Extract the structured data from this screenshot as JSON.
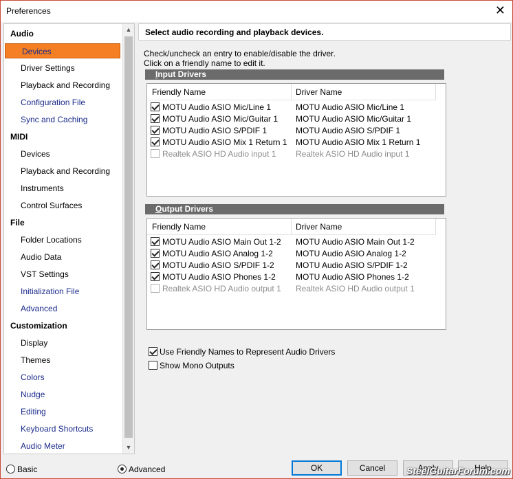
{
  "window": {
    "title": "Preferences",
    "close_glyph": "✕"
  },
  "sidebar": {
    "items": [
      {
        "label": "Audio",
        "kind": "head"
      },
      {
        "label": "Devices",
        "kind": "sub",
        "selected": true
      },
      {
        "label": "Driver Settings",
        "kind": "sub"
      },
      {
        "label": "Playback and Recording",
        "kind": "sub"
      },
      {
        "label": "Configuration File",
        "kind": "sub",
        "link": true
      },
      {
        "label": "Sync and Caching",
        "kind": "sub",
        "link": true
      },
      {
        "label": "MIDI",
        "kind": "head"
      },
      {
        "label": "Devices",
        "kind": "sub"
      },
      {
        "label": "Playback and Recording",
        "kind": "sub"
      },
      {
        "label": "Instruments",
        "kind": "sub"
      },
      {
        "label": "Control Surfaces",
        "kind": "sub"
      },
      {
        "label": "File",
        "kind": "head"
      },
      {
        "label": "Folder Locations",
        "kind": "sub"
      },
      {
        "label": "Audio Data",
        "kind": "sub"
      },
      {
        "label": "VST Settings",
        "kind": "sub"
      },
      {
        "label": "Initialization File",
        "kind": "sub",
        "link": true
      },
      {
        "label": "Advanced",
        "kind": "sub",
        "link": true
      },
      {
        "label": "Customization",
        "kind": "head"
      },
      {
        "label": "Display",
        "kind": "sub"
      },
      {
        "label": "Themes",
        "kind": "sub"
      },
      {
        "label": "Colors",
        "kind": "sub",
        "link": true
      },
      {
        "label": "Nudge",
        "kind": "sub",
        "link": true
      },
      {
        "label": "Editing",
        "kind": "sub",
        "link": true
      },
      {
        "label": "Keyboard Shortcuts",
        "kind": "sub",
        "link": true
      },
      {
        "label": "Audio Meter",
        "kind": "sub",
        "link": true
      }
    ]
  },
  "main": {
    "header": "Select audio recording and playback devices.",
    "instruction_1": "Check/uncheck an entry to enable/disable the driver.",
    "instruction_2": "Click on a friendly name to edit it.",
    "input_drivers": {
      "title_accel": "I",
      "title_rest": "nput Drivers",
      "col_friendly": "Friendly Name",
      "col_driver": "Driver Name",
      "rows": [
        {
          "friendly": "MOTU Audio ASIO Mic/Line 1",
          "driver": "MOTU Audio ASIO Mic/Line 1",
          "checked": true
        },
        {
          "friendly": "MOTU Audio ASIO Mic/Guitar 1",
          "driver": "MOTU Audio ASIO Mic/Guitar 1",
          "checked": true
        },
        {
          "friendly": "MOTU Audio ASIO S/PDIF 1",
          "driver": "MOTU Audio ASIO S/PDIF 1",
          "checked": true
        },
        {
          "friendly": "MOTU Audio ASIO Mix 1 Return 1",
          "driver": "MOTU Audio ASIO Mix 1 Return 1",
          "checked": true
        },
        {
          "friendly": "Realtek ASIO HD Audio input 1",
          "driver": "Realtek ASIO HD Audio input 1",
          "checked": false
        }
      ]
    },
    "output_drivers": {
      "title_accel": "O",
      "title_rest": "utput Drivers",
      "col_friendly": "Friendly Name",
      "col_driver": "Driver Name",
      "rows": [
        {
          "friendly": "MOTU Audio ASIO Main Out 1-2",
          "driver": "MOTU Audio ASIO Main Out 1-2",
          "checked": true
        },
        {
          "friendly": "MOTU Audio ASIO Analog 1-2",
          "driver": "MOTU Audio ASIO Analog 1-2",
          "checked": true
        },
        {
          "friendly": "MOTU Audio ASIO S/PDIF 1-2",
          "driver": "MOTU Audio ASIO S/PDIF 1-2",
          "checked": true
        },
        {
          "friendly": "MOTU Audio ASIO Phones 1-2",
          "driver": "MOTU Audio ASIO Phones 1-2",
          "checked": true
        },
        {
          "friendly": "Realtek ASIO HD Audio output 1",
          "driver": "Realtek ASIO HD Audio output 1",
          "checked": false
        }
      ]
    },
    "options": {
      "friendly_names": {
        "label": "Use Friendly Names to Represent Audio Drivers",
        "checked": true
      },
      "mono_outputs": {
        "label": "Show Mono Outputs",
        "checked": false
      }
    }
  },
  "footer": {
    "basic_label": "Basic",
    "advanced_label": "Advanced",
    "mode_selected": "Advanced",
    "ok_label": "OK",
    "cancel_label": "Cancel",
    "apply_label": "Apply",
    "help_label": "Help",
    "watermark": "SteelGuitarForum.com"
  }
}
